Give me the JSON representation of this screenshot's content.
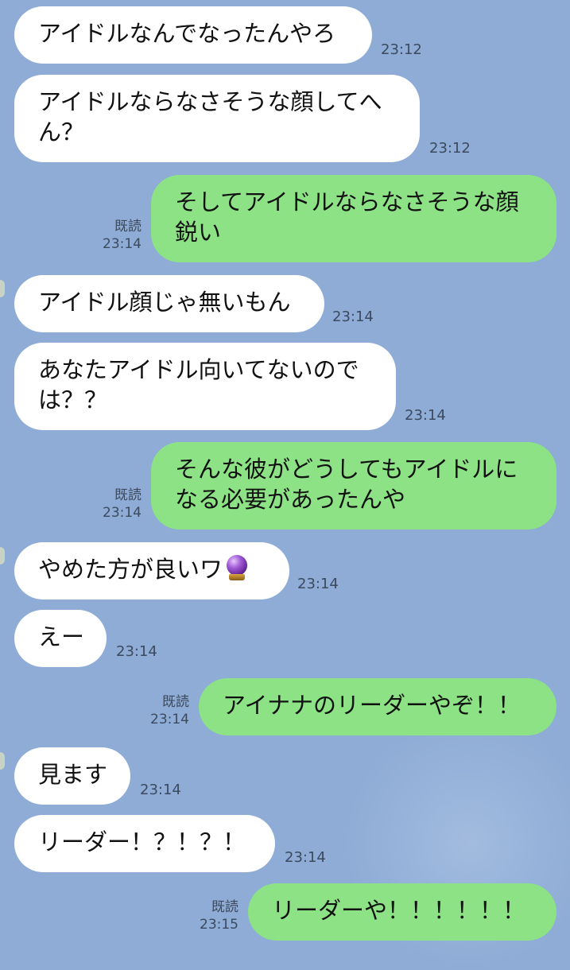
{
  "messages": [
    {
      "side": "in",
      "text": "アイドルなんでなったんやろ",
      "time": "23:12"
    },
    {
      "side": "in",
      "line1": "アイドルならなさそうな顔してへ",
      "line2": "ん？",
      "time": "23:12"
    },
    {
      "side": "out",
      "line1": "そしてアイドルならなさそうな顔",
      "line2": "鋭い",
      "read": "既読",
      "time": "23:14"
    },
    {
      "side": "in",
      "text": "アイドル顔じゃ無いもん",
      "time": "23:14"
    },
    {
      "side": "in",
      "line1": "あなたアイドル向いてないので",
      "line2": "は？？",
      "time": "23:14"
    },
    {
      "side": "out",
      "line1": "そんな彼がどうしてもアイドルに",
      "line2": "なる必要があったんや",
      "read": "既読",
      "time": "23:14"
    },
    {
      "side": "in",
      "text": "やめた方が良いワ",
      "emoji": "crystal-ball-icon",
      "time": "23:14"
    },
    {
      "side": "in",
      "text": "えー",
      "time": "23:14"
    },
    {
      "side": "out",
      "text": "アイナナのリーダーやぞ！！",
      "read": "既読",
      "time": "23:14"
    },
    {
      "side": "in",
      "text": "見ます",
      "time": "23:14"
    },
    {
      "side": "in",
      "text": "リーダー！？！？！",
      "time": "23:14"
    },
    {
      "side": "out",
      "text": "リーダーや！！！！！！",
      "read": "既読",
      "time": "23:15"
    }
  ],
  "colors": {
    "background": "#8eacd6",
    "incoming_bubble": "#ffffff",
    "outgoing_bubble": "#8de285",
    "timestamp": "#3b4a5f"
  }
}
